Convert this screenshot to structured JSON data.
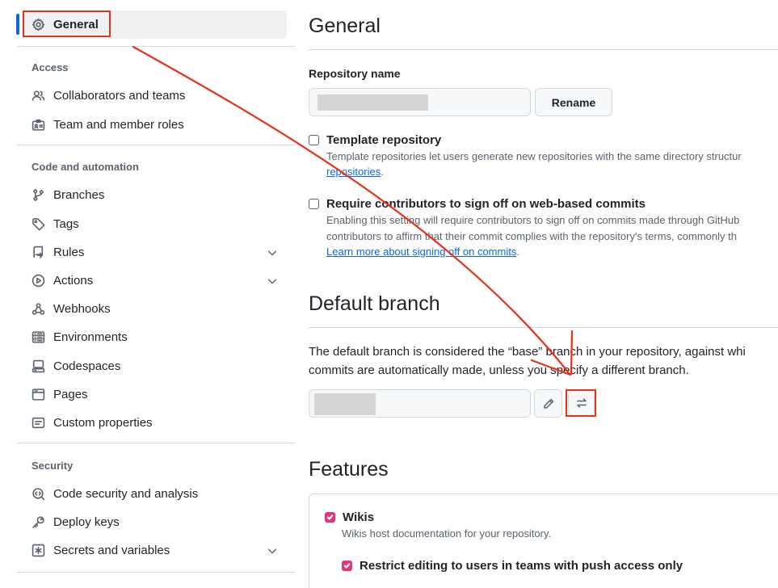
{
  "sidebar": {
    "general": {
      "label": "General",
      "icon": "gear-icon"
    },
    "sections": [
      {
        "heading": "Access",
        "items": [
          {
            "label": "Collaborators and teams",
            "icon": "people-icon"
          },
          {
            "label": "Team and member roles",
            "icon": "id-badge-icon"
          }
        ]
      },
      {
        "heading": "Code and automation",
        "items": [
          {
            "label": "Branches",
            "icon": "git-branch-icon"
          },
          {
            "label": "Tags",
            "icon": "tag-icon"
          },
          {
            "label": "Rules",
            "icon": "repo-push-icon",
            "expandable": true
          },
          {
            "label": "Actions",
            "icon": "play-icon",
            "expandable": true
          },
          {
            "label": "Webhooks",
            "icon": "webhook-icon"
          },
          {
            "label": "Environments",
            "icon": "server-icon"
          },
          {
            "label": "Codespaces",
            "icon": "codespaces-icon"
          },
          {
            "label": "Pages",
            "icon": "browser-icon"
          },
          {
            "label": "Custom properties",
            "icon": "note-icon"
          }
        ]
      },
      {
        "heading": "Security",
        "items": [
          {
            "label": "Code security and analysis",
            "icon": "codescan-icon"
          },
          {
            "label": "Deploy keys",
            "icon": "key-icon"
          },
          {
            "label": "Secrets and variables",
            "icon": "key-asterisk-icon",
            "expandable": true
          }
        ]
      }
    ]
  },
  "main": {
    "general_title": "General",
    "repo_name_label": "Repository name",
    "rename_button": "Rename",
    "template": {
      "title": "Template repository",
      "desc_line1": "Template repositories let users generate new repositories with the same directory structur",
      "desc_link": "repositories",
      "desc_tail": "."
    },
    "signoff": {
      "title": "Require contributors to sign off on web-based commits",
      "desc_line1": "Enabling this setting will require contributors to sign off on commits made through GitHub",
      "desc_line2": "contributors to affirm that their commit complies with the repository's terms, commonly th",
      "desc_link": "Learn more about signing off on commits",
      "desc_tail": "."
    },
    "default_branch_title": "Default branch",
    "default_branch_line1": "The default branch is considered the “base” branch in your repository, against whi",
    "default_branch_line2": "commits are automatically made, unless you specify a different branch.",
    "features_title": "Features",
    "wikis": {
      "title": "Wikis",
      "desc": "Wikis host documentation for your repository.",
      "checked": true
    },
    "restrict": {
      "title": "Restrict editing to users in teams with push access only",
      "checked": true
    }
  },
  "annotation": {
    "color": "#e8311a"
  }
}
